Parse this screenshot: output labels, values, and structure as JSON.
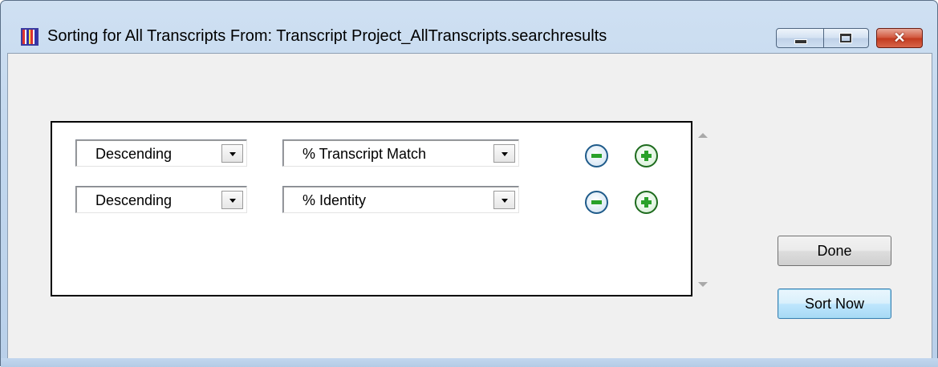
{
  "window": {
    "title": "Sorting for All Transcripts From: Transcript Project_AllTranscripts.searchresults",
    "app_icon": "grid-app-icon",
    "controls": {
      "minimize_icon": "minimize-icon",
      "maximize_icon": "maximize-icon",
      "close_glyph": "✕"
    }
  },
  "sort_rules": [
    {
      "order": "Descending",
      "field": "% Transcript Match"
    },
    {
      "order": "Descending",
      "field": "% Identity"
    }
  ],
  "buttons": {
    "done": "Done",
    "sort_now": "Sort Now"
  },
  "colors": {
    "titlebar": "#c2d7ee",
    "close_button": "#c23a1f",
    "remove_icon": "#1f5b8a",
    "add_icon": "#2aa12a"
  }
}
